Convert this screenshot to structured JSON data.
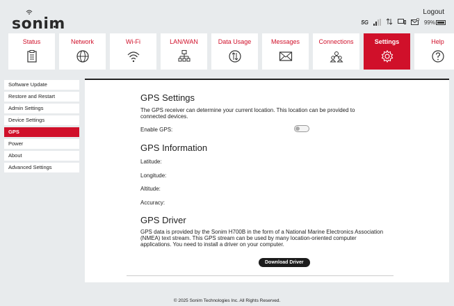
{
  "brand": {
    "name": "sonim",
    "accent": "#d0102a"
  },
  "header": {
    "logout_label": "Logout",
    "network_type": "5G",
    "battery_percent": "99%",
    "battery_level": 0.99
  },
  "nav": {
    "tabs": [
      {
        "label": "Status",
        "icon": "status-clipboard-icon"
      },
      {
        "label": "Network",
        "icon": "globe-icon"
      },
      {
        "label": "Wi-Fi",
        "icon": "wifi-icon"
      },
      {
        "label": "LAN/WAN",
        "icon": "lan-network-icon"
      },
      {
        "label": "Data Usage",
        "icon": "data-arrows-icon"
      },
      {
        "label": "Messages",
        "icon": "envelope-icon"
      },
      {
        "label": "Connections",
        "icon": "users-icon"
      },
      {
        "label": "Settings",
        "icon": "gear-icon",
        "active": true
      },
      {
        "label": "Help",
        "icon": "help-icon"
      }
    ]
  },
  "sidebar": {
    "items": [
      {
        "label": "Software Update"
      },
      {
        "label": "Restore and Restart"
      },
      {
        "label": "Admin Settings"
      },
      {
        "label": "Device Settings"
      },
      {
        "label": "GPS",
        "active": true
      },
      {
        "label": "Power"
      },
      {
        "label": "About"
      },
      {
        "label": "Advanced Settings"
      }
    ]
  },
  "gps_settings": {
    "title": "GPS Settings",
    "description_line1": "The GPS receiver can determine your current location. This location can be provided to",
    "description_line2": "connected devices.",
    "enable_label": "Enable GPS:",
    "enabled": false
  },
  "gps_info": {
    "title": "GPS Information",
    "latitude_label": "Latitude:",
    "longitude_label": "Longitude:",
    "altitude_label": "Altitude:",
    "accuracy_label": "Accuracy:"
  },
  "gps_driver": {
    "title": "GPS Driver",
    "line1": "GPS data is provided by the Sonim H700B in the form of a National Marine Electronics Association",
    "line2": "(NMEA) text stream. This GPS stream can be used by many location-oriented computer",
    "line3": "applications. You need to install a driver on your computer.",
    "button_label": "Download Driver"
  },
  "footer": {
    "copyright": "© 2025 Sonim Technologies Inc. All Rights Reserved."
  }
}
